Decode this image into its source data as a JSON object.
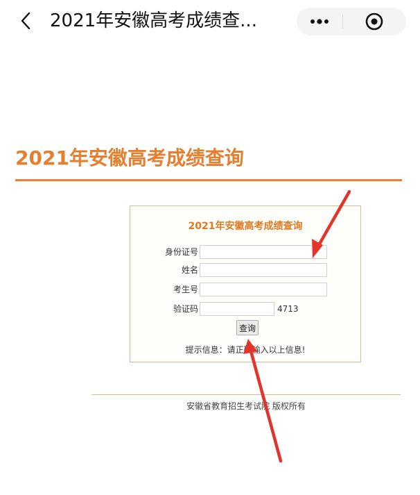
{
  "nav": {
    "title": "2021年安徽高考成绩查...",
    "back_icon": "chevron-left-icon",
    "more_icon": "more-dots-icon",
    "close_icon": "target-close-icon"
  },
  "page": {
    "heading": "2021年安徽高考成绩查询"
  },
  "form": {
    "title": "2021年安徽高考成绩查询",
    "fields": [
      {
        "label": "身份证号",
        "value": ""
      },
      {
        "label": "姓名",
        "value": ""
      },
      {
        "label": "考生号",
        "value": ""
      },
      {
        "label": "验证码",
        "value": ""
      }
    ],
    "captcha_code": "4713",
    "submit_label": "查询",
    "tip": "提示信息：请正确输入以上信息!"
  },
  "footer": {
    "copyright": "安徽省教育招生考试院 版权所有"
  },
  "colors": {
    "accent": "#e67e2e",
    "annotation_arrow": "#e2342b"
  }
}
